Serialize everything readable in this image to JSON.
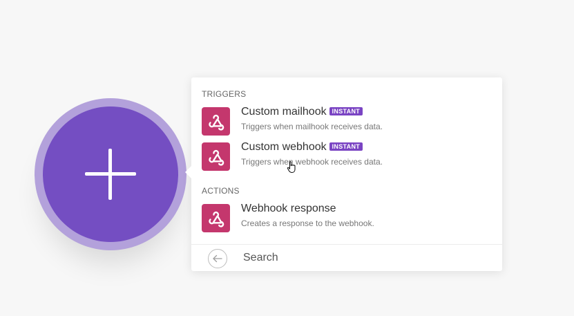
{
  "popup": {
    "sections": [
      {
        "title": "TRIGGERS",
        "items": [
          {
            "label": "Custom mailhook",
            "badge": "INSTANT",
            "description": "Triggers when mailhook receives data.",
            "icon": "webhook-icon"
          },
          {
            "label": "Custom webhook",
            "badge": "INSTANT",
            "description": "Triggers when webhook receives data.",
            "icon": "webhook-icon"
          }
        ]
      },
      {
        "title": "ACTIONS",
        "items": [
          {
            "label": "Webhook response",
            "description": "Creates a response to the webhook.",
            "icon": "webhook-icon"
          }
        ]
      }
    ],
    "search": {
      "placeholder": "Search",
      "back_icon": "arrow-left-circle-icon"
    }
  },
  "add_module": {
    "icon": "plus-icon"
  },
  "colors": {
    "brand_purple": "#744ec2",
    "ring_purple": "#b3a1db",
    "badge_purple": "#7a44c3",
    "app_icon_bg": "#c4376d"
  }
}
